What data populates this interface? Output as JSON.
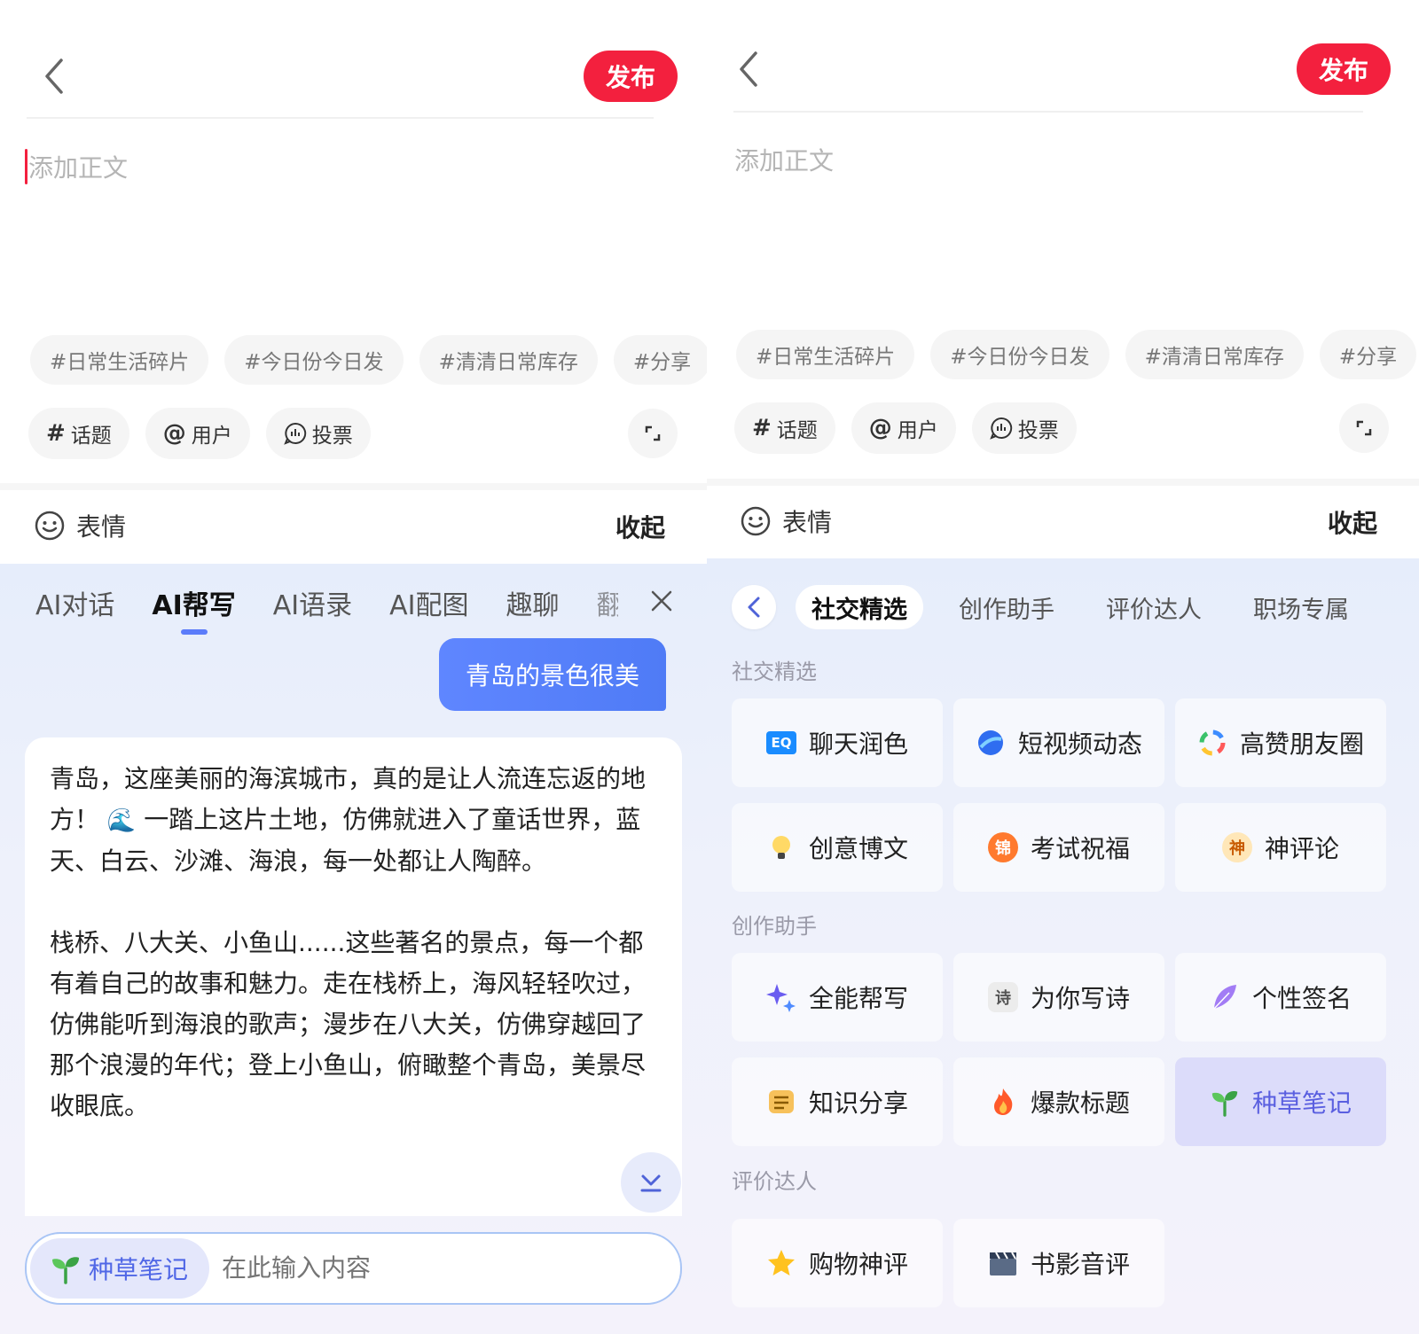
{
  "header": {
    "publish_label": "发布"
  },
  "editor": {
    "body_placeholder": "添加正文"
  },
  "tags": [
    "#日常生活碎片",
    "#今日份今日发",
    "#清清日常库存",
    "#分享"
  ],
  "tools": {
    "topic_label": "话题",
    "user_label": "用户",
    "vote_label": "投票"
  },
  "emoji_bar": {
    "emoji_label": "表情",
    "collapse_label": "收起"
  },
  "ai_panel": {
    "tabs": [
      "AI对话",
      "AI帮写",
      "AI语录",
      "AI配图",
      "趣聊",
      "翻"
    ],
    "active_tab": "AI帮写",
    "user_message": "青岛的景色很美",
    "answer_paragraph_1_a": "青岛，这座美丽的海滨城市，真的是让人流连忘返的地方！",
    "answer_paragraph_1_b": "一踏上这片土地，仿佛就进入了童话世界，蓝天、白云、沙滩、海浪，每一处都让人陶醉。",
    "answer_paragraph_2": "栈桥、八大关、小鱼山......这些著名的景点，每一个都有着自己的故事和魅力。走在栈桥上，海风轻轻吹过，仿佛能听到海浪的歌声；漫步在八大关，仿佛穿越回了那个浪漫的年代；登上小鱼山，俯瞰整个青岛，美景尽收眼底。",
    "mode_chip_label": "种草笔记",
    "input_placeholder": "在此输入内容"
  },
  "templates": {
    "category_tabs": [
      "社交精选",
      "创作助手",
      "评价达人",
      "职场专属"
    ],
    "active_category": "社交精选",
    "sections": [
      {
        "label": "社交精选",
        "items": [
          {
            "label": "聊天润色",
            "icon": "eq-icon"
          },
          {
            "label": "短视频动态",
            "icon": "planet-icon"
          },
          {
            "label": "高赞朋友圈",
            "icon": "rainbow-ring-icon"
          },
          {
            "label": "创意博文",
            "icon": "lightbulb-icon"
          },
          {
            "label": "考试祝福",
            "icon": "jin-badge-icon",
            "glyph": "锦"
          },
          {
            "label": "神评论",
            "icon": "shen-badge-icon",
            "glyph": "神"
          }
        ]
      },
      {
        "label": "创作助手",
        "items": [
          {
            "label": "全能帮写",
            "icon": "sparkle-icon"
          },
          {
            "label": "为你写诗",
            "icon": "shi-badge-icon",
            "glyph": "诗"
          },
          {
            "label": "个性签名",
            "icon": "feather-icon"
          },
          {
            "label": "知识分享",
            "icon": "notebook-icon"
          },
          {
            "label": "爆款标题",
            "icon": "fire-icon"
          },
          {
            "label": "种草笔记",
            "icon": "sprout-icon",
            "selected": true
          }
        ]
      },
      {
        "label": "评价达人",
        "items": [
          {
            "label": "购物神评",
            "icon": "star-icon"
          },
          {
            "label": "书影音评",
            "icon": "clapperboard-icon"
          }
        ]
      }
    ]
  },
  "colors": {
    "brand_red": "#f3203e",
    "ai_blue": "#5b7cfa",
    "selected_card_bg": "#dcdcfa"
  }
}
